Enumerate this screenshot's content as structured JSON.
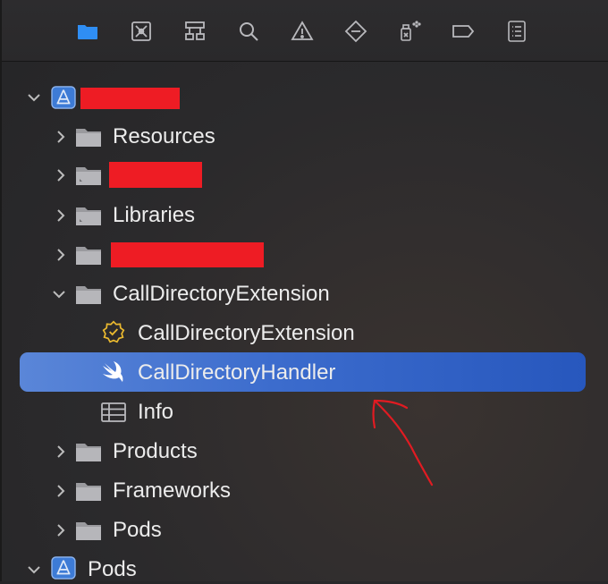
{
  "toolbar": {
    "icons": [
      {
        "name": "folder-icon",
        "active": true
      },
      {
        "name": "source-control-icon",
        "active": false
      },
      {
        "name": "hierarchy-icon",
        "active": false
      },
      {
        "name": "search-icon",
        "active": false
      },
      {
        "name": "warning-icon",
        "active": false
      },
      {
        "name": "test-diamond-icon",
        "active": false
      },
      {
        "name": "debug-spray-icon",
        "active": false
      },
      {
        "name": "breakpoint-tag-icon",
        "active": false
      },
      {
        "name": "report-list-icon",
        "active": false
      }
    ]
  },
  "tree": {
    "items": [
      {
        "label": "",
        "redacted": true,
        "icon": "app-project-icon",
        "expanded": true
      },
      {
        "label": "Resources",
        "icon": "folder-icon",
        "expanded": false
      },
      {
        "label": "",
        "redacted": true,
        "icon": "folder-icon",
        "expanded": false
      },
      {
        "label": "Libraries",
        "icon": "folder-icon",
        "expanded": false
      },
      {
        "label": "",
        "redacted": true,
        "icon": "folder-icon",
        "expanded": false
      },
      {
        "label": "CallDirectoryExtension",
        "icon": "folder-icon",
        "expanded": true
      },
      {
        "label": "CallDirectoryExtension",
        "icon": "entitlements-badge-icon"
      },
      {
        "label": "CallDirectoryHandler",
        "icon": "swift-icon",
        "selected": true
      },
      {
        "label": "Info",
        "icon": "plist-table-icon"
      },
      {
        "label": "Products",
        "icon": "folder-icon",
        "expanded": false
      },
      {
        "label": "Frameworks",
        "icon": "folder-icon",
        "expanded": false
      },
      {
        "label": "Pods",
        "icon": "folder-icon",
        "expanded": false
      },
      {
        "label": "Pods",
        "icon": "app-project-icon",
        "expanded": true
      }
    ]
  },
  "colors": {
    "accent": "#3d6fd0",
    "toolbar_active": "#2f8ef4",
    "icon_gray": "#b9b9bd",
    "redaction": "#ee1c24",
    "annotation_arrow": "#e11b22"
  }
}
